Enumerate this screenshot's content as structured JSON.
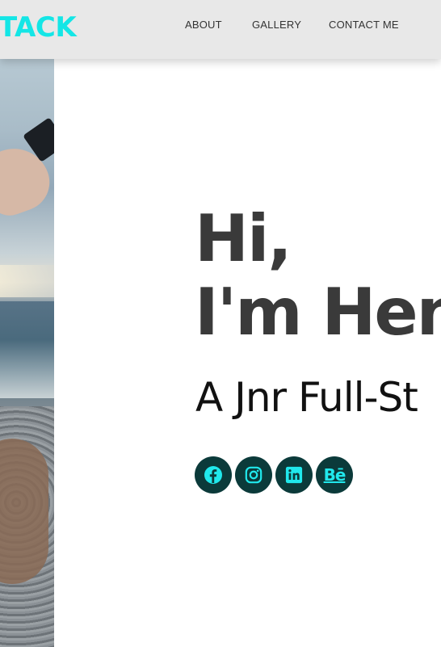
{
  "header": {
    "logo": "TACK",
    "nav": [
      "ABOUT",
      "GALLERY",
      "CONTACT ME"
    ]
  },
  "hero": {
    "line1": "Hi,",
    "line2": "I'm Hen",
    "subtitle": "A Jnr Full-St"
  },
  "socials": [
    {
      "name": "facebook-icon",
      "label": ""
    },
    {
      "name": "instagram-icon",
      "label": ""
    },
    {
      "name": "linkedin-icon",
      "label": ""
    },
    {
      "name": "behance-icon",
      "label": "Bē"
    }
  ],
  "colors": {
    "brand": "#14e6e6",
    "header_bg": "#e8e8e8",
    "icon_bg": "#0b3a3a",
    "icon_fg": "#20e8ec",
    "heading": "#3a3a3a"
  }
}
